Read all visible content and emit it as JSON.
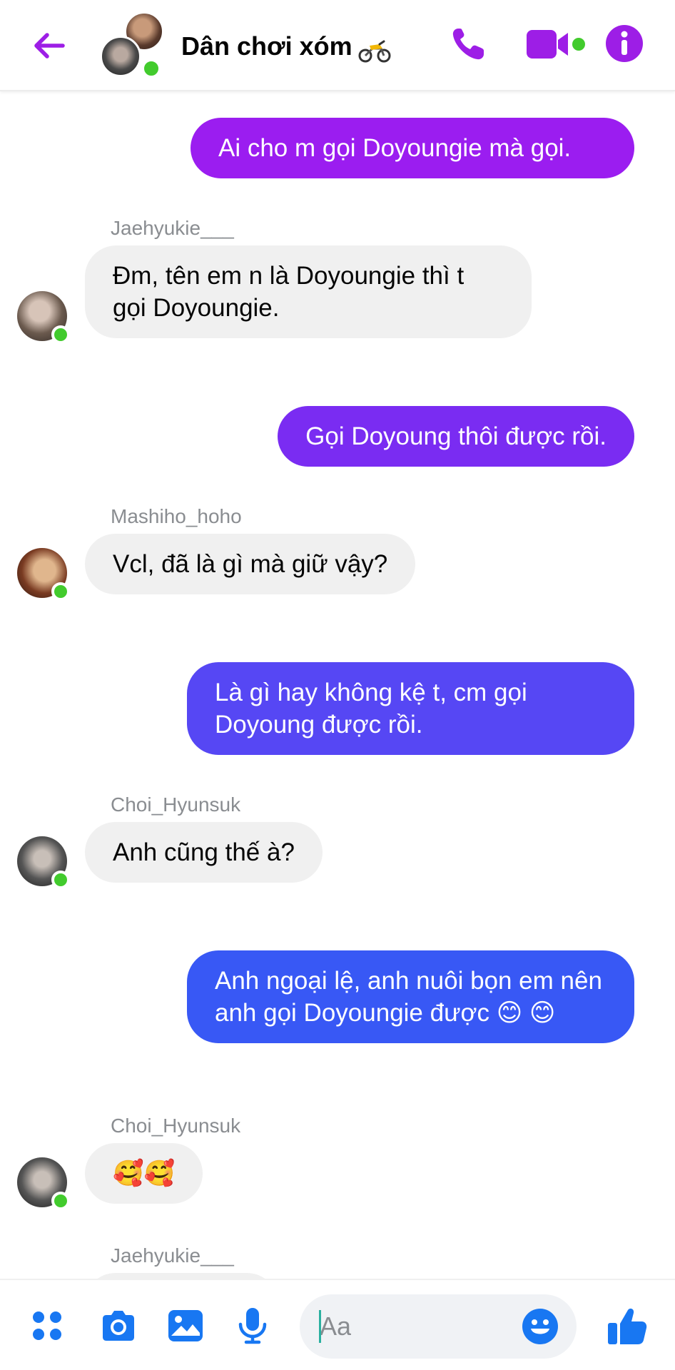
{
  "header": {
    "title": "Dân chơi xóm",
    "back_icon": "arrow-left-icon",
    "actions": [
      "phone-icon",
      "video-camera-icon",
      "info-icon"
    ],
    "accent_color": "#9d1ee6",
    "online_color": "#42cb2d"
  },
  "messages": [
    {
      "direction": "out",
      "text": "Ai cho m gọi Doyoungie mà gọi.",
      "color": "#9b1df0"
    },
    {
      "direction": "in",
      "sender": "Jaehyukie___",
      "text": "Đm, tên em n là Doyoungie thì t gọi Doyoungie."
    },
    {
      "direction": "out",
      "text": "Gọi Doyoung thôi được rồi.",
      "color": "#7a2cf2"
    },
    {
      "direction": "in",
      "sender": "Mashiho_hoho",
      "text": "Vcl, đã là gì mà giữ vậy?"
    },
    {
      "direction": "out",
      "text": "Là gì hay không kệ t, cm gọi Doyoung được rồi.",
      "color": "#5647f4"
    },
    {
      "direction": "in",
      "sender": "Choi_Hyunsuk",
      "text": "Anh cũng thế à?"
    },
    {
      "direction": "out",
      "text": "Anh ngoại lệ, anh nuôi bọn em nên anh gọi Doyoungie được 😊 😊",
      "color": "#3858f5"
    },
    {
      "direction": "in",
      "sender": "Choi_Hyunsuk",
      "text": "🥰🥰"
    },
    {
      "direction": "in",
      "sender": "Jaehyukie___",
      "text": ""
    }
  ],
  "composer": {
    "placeholder": "Aa",
    "value": "",
    "icons": [
      "menu-dots-icon",
      "camera-icon",
      "image-icon",
      "microphone-icon",
      "emoji-icon",
      "thumbs-up-icon"
    ],
    "icon_color": "#1877f2"
  }
}
